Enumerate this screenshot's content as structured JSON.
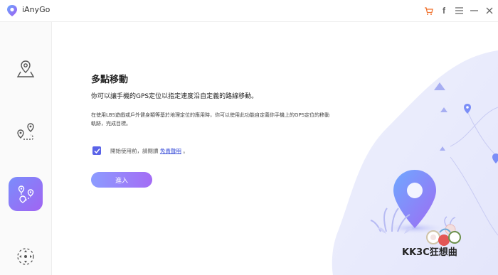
{
  "app": {
    "name": "iAnyGo"
  },
  "main": {
    "title": "多點移動",
    "subtitle": "你可以讓手機的GPS定位以指定速度沿自定義的路線移動。",
    "description": "在使用LBS遊戲或戶外健身類等基於地理定位的應用時，你可以使用此功能自定義你手機上的GPS定位的移動軌跡，完成目標。",
    "agree_prefix": "開始使用前，請閱讀",
    "agree_link": "免責聲明",
    "agree_suffix": "。",
    "enter_label": "進入"
  },
  "watermark": {
    "text": "KK3C狂想曲"
  },
  "colors": {
    "accent": "#7a8dfc",
    "accent2": "#a164f2",
    "cart": "#f0712c",
    "link": "#3b4fd8"
  },
  "icons": {
    "titlebar": [
      "cart-icon",
      "facebook-icon",
      "menu-icon",
      "minimize-icon",
      "close-icon"
    ]
  }
}
